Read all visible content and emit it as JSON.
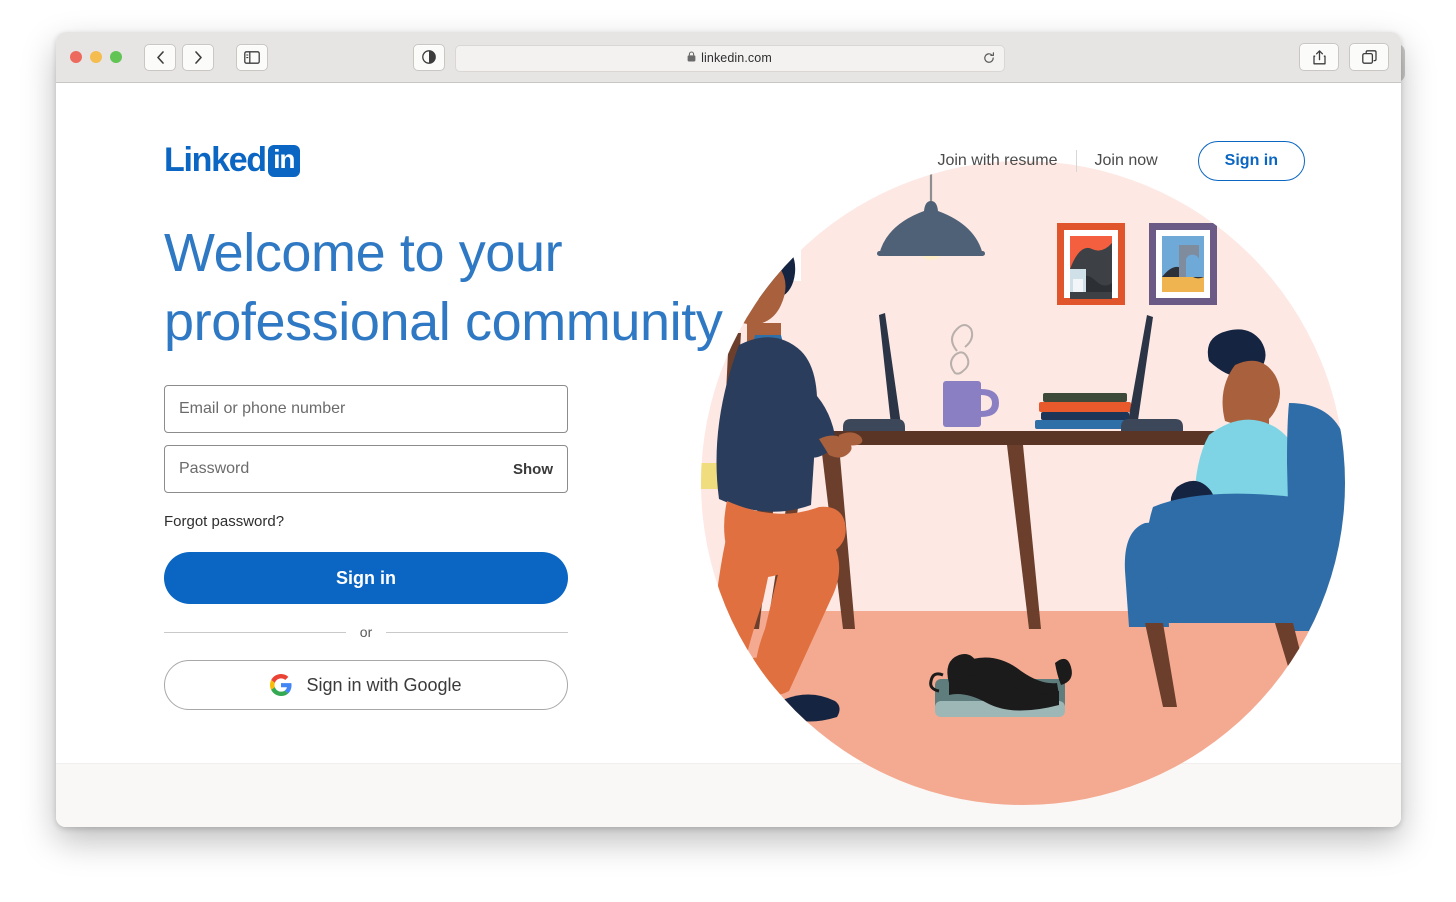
{
  "browser": {
    "url": "linkedin.com",
    "lock_icon": "lock-icon",
    "back_icon": "chevron-left-icon",
    "forward_icon": "chevron-right-icon",
    "sidebar_icon": "sidebar-toggle-icon",
    "reader_icon": "reader-view-icon",
    "reload_icon": "reload-icon",
    "share_icon": "share-icon",
    "tabs_icon": "tab-overview-icon",
    "new_tab_label": "+"
  },
  "header": {
    "logo_text": "Linked",
    "logo_badge": "in",
    "nav": [
      {
        "label": "Join with resume"
      },
      {
        "label": "Join now"
      }
    ],
    "signin_button": "Sign in"
  },
  "main": {
    "headline": "Welcome to your professional community",
    "email_placeholder": "Email or phone number",
    "email_value": "",
    "password_placeholder": "Password",
    "password_value": "",
    "show_label": "Show",
    "forgot_label": "Forgot password?",
    "signin_label": "Sign in",
    "or_label": "or",
    "google_label": "Sign in with Google",
    "google_icon": "google-g-icon"
  },
  "colors": {
    "brand_blue": "#0a66c2",
    "headline_blue": "#2f79c4",
    "circle_pink": "#fde8e4",
    "floor_salmon": "#f4a991",
    "chair_blue": "#2e6da8",
    "sweater_navy": "#2b3d5c",
    "pants_orange": "#e0703f",
    "desk_brown": "#5a3526",
    "lamp_slate": "#4f6176",
    "footer_bg": "#f9f8f6"
  }
}
